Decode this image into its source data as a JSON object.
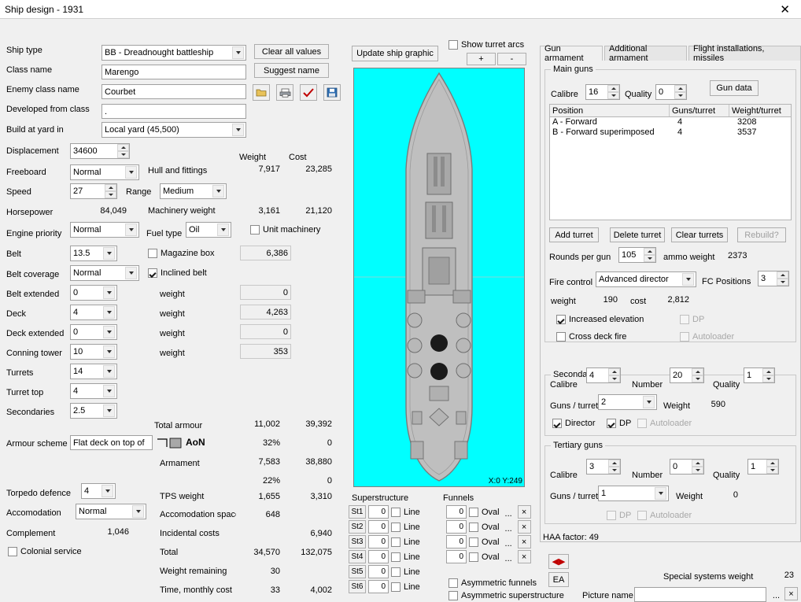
{
  "window": {
    "title": "Ship design - 1931",
    "close_icon": "close-icon"
  },
  "left": {
    "labels": {
      "ship_type": "Ship type",
      "class_name": "Class name",
      "enemy_class_name": "Enemy class name",
      "developed_from_class": "Developed from class",
      "build_at_yard_in": "Build at yard in",
      "displacement": "Displacement",
      "freeboard": "Freeboard",
      "speed": "Speed",
      "range": "Range",
      "horsepower": "Horsepower",
      "engine_priority": "Engine priority",
      "fuel_type": "Fuel type",
      "belt": "Belt",
      "belt_coverage": "Belt coverage",
      "belt_extended": "Belt extended",
      "deck": "Deck",
      "deck_extended": "Deck extended",
      "conning_tower": "Conning tower",
      "turrets": "Turrets",
      "turret_top": "Turret top",
      "secondaries": "Secondaries",
      "armour_scheme": "Armour scheme",
      "torpedo_defence": "Torpedo defence",
      "accomodation": "Accomodation",
      "complement": "Complement",
      "colonial_service": "Colonial service",
      "magazine_box": "Magazine box",
      "inclined_belt": "Inclined belt",
      "unit_machinery": "Unit machinery",
      "hull_and_fittings": "Hull and fittings",
      "machinery_weight": "Machinery weight",
      "weight": "weight",
      "total_armour": "Total armour",
      "armament": "Armament",
      "tps_weight": "TPS weight",
      "accomodation_space": "Accomodation space",
      "incidental_costs": "Incidental costs",
      "total": "Total",
      "weight_remaining": "Weight remaining",
      "time_monthly_cost": "Time, monthly cost",
      "aon": "AoN",
      "weight_col": "Weight",
      "cost_col": "Cost"
    },
    "values": {
      "ship_type": "BB - Dreadnought battleship",
      "class_name": "Marengo",
      "enemy_class_name": "Courbet",
      "developed_from_class": ".",
      "build_at_yard_in": "Local yard (45,500)",
      "displacement": "34600",
      "freeboard": "Normal",
      "speed": "27",
      "range": "Medium",
      "horsepower": "84,049",
      "engine_priority": "Normal",
      "fuel_type": "Oil",
      "belt": "13.5",
      "belt_coverage": "Normal",
      "belt_extended": "0",
      "deck": "4",
      "deck_extended": "0",
      "conning_tower": "10",
      "turrets": "14",
      "turret_top": "4",
      "secondaries": "2.5",
      "armour_scheme": "Flat deck on top of",
      "torpedo_defence": "4",
      "accomodation": "Normal",
      "complement": "1,046"
    },
    "buttons": {
      "clear_all_values": "Clear all values",
      "suggest_name": "Suggest name",
      "update_ship_graphic": "Update ship graphic",
      "folder_icon": "folder-open-icon",
      "print_icon": "print-icon",
      "check_icon": "check-icon",
      "save_icon": "save-icon",
      "show_turret_arcs": "Show turret arcs",
      "plus": "+",
      "minus": "-"
    },
    "weights": [
      {
        "name": "hull_and_fittings",
        "weight": "7,917",
        "cost": "23,285"
      },
      {
        "name": "machinery_weight",
        "weight": "3,161",
        "cost": "21,120"
      },
      {
        "name": "magazine_box_weight",
        "weight": "6,386",
        "cost": ""
      },
      {
        "name": "belt_weight",
        "weight": "0",
        "cost": ""
      },
      {
        "name": "deck_weight",
        "weight": "4,263",
        "cost": ""
      },
      {
        "name": "deck_ext_weight",
        "weight": "0",
        "cost": ""
      },
      {
        "name": "conning_weight",
        "weight": "353",
        "cost": ""
      },
      {
        "name": "total_armour",
        "weight": "11,002",
        "cost": "39,392"
      },
      {
        "name": "armour_pct",
        "weight": "32%",
        "cost": "0"
      },
      {
        "name": "armament",
        "weight": "7,583",
        "cost": "38,880"
      },
      {
        "name": "armament_pct",
        "weight": "22%",
        "cost": "0"
      },
      {
        "name": "tps_weight",
        "weight": "1,655",
        "cost": "3,310"
      },
      {
        "name": "accomodation_space",
        "weight": "648",
        "cost": ""
      },
      {
        "name": "incidental_costs",
        "weight": "",
        "cost": "6,940"
      },
      {
        "name": "total",
        "weight": "34,570",
        "cost": "132,075"
      },
      {
        "name": "weight_remaining",
        "weight": "30",
        "cost": ""
      },
      {
        "name": "time_monthly_cost",
        "weight": "33",
        "cost": "4,002"
      }
    ]
  },
  "tabs": [
    {
      "label": "Gun armament",
      "selected": true
    },
    {
      "label": "Additional armament",
      "selected": false
    },
    {
      "label": "Flight installations, missiles",
      "selected": false
    }
  ],
  "main_guns": {
    "caption": "Main guns",
    "calibre_label": "Calibre",
    "calibre": "16",
    "quality_label": "Quality",
    "quality": "0",
    "gun_data_button": "Gun data",
    "columns": [
      "Position",
      "Guns/turret",
      "Weight/turret"
    ],
    "rows": [
      {
        "position": "A - Forward",
        "guns": "4",
        "weight": "3208"
      },
      {
        "position": "B - Forward superimposed",
        "guns": "4",
        "weight": "3537"
      }
    ],
    "add_turret": "Add turret",
    "delete_turret": "Delete turret",
    "clear_turrets": "Clear turrets",
    "rebuild": "Rebuild?",
    "rounds_per_gun_label": "Rounds per gun",
    "rounds_per_gun": "105",
    "ammo_weight_label": "ammo weight",
    "ammo_weight": "2373",
    "fire_control_label": "Fire control",
    "fire_control": "Advanced director",
    "fc_positions_label": "FC Positions",
    "fc_positions": "3",
    "weight_label": "weight",
    "weight": "190",
    "cost_label": "cost",
    "cost": "2,812",
    "increased_elevation": "Increased elevation",
    "dp": "DP",
    "cross_deck_fire": "Cross deck fire",
    "autoloader": "Autoloader"
  },
  "secondary_guns": {
    "caption": "Secondary guns",
    "calibre_label": "Calibre",
    "calibre": "4",
    "number_label": "Number",
    "number": "20",
    "quality_label": "Quality",
    "quality": "1",
    "guns_per_turret_label": "Guns / turret",
    "guns_per_turret": "2",
    "weight_label": "Weight",
    "weight": "590",
    "director": "Director",
    "dp": "DP",
    "autoloader": "Autoloader"
  },
  "tertiary_guns": {
    "caption": "Tertiary guns",
    "calibre_label": "Calibre",
    "calibre": "3",
    "number_label": "Number",
    "number": "0",
    "quality_label": "Quality",
    "quality": "1",
    "guns_per_turret_label": "Guns / turret",
    "guns_per_turret": "1",
    "weight_label": "Weight",
    "weight": "0",
    "dp": "DP",
    "autoloader": "Autoloader"
  },
  "haa_factor": "HAA factor: 49",
  "superstructure": {
    "caption": "Superstructure",
    "rows": [
      {
        "btn": "St1",
        "value": "0",
        "shape": "Line"
      },
      {
        "btn": "St2",
        "value": "0",
        "shape": "Line"
      },
      {
        "btn": "St3",
        "value": "0",
        "shape": "Line"
      },
      {
        "btn": "St4",
        "value": "0",
        "shape": "Line"
      },
      {
        "btn": "St5",
        "value": "0",
        "shape": "Line"
      },
      {
        "btn": "St6",
        "value": "0",
        "shape": "Line"
      }
    ]
  },
  "funnels": {
    "caption": "Funnels",
    "rows": [
      {
        "value": "0",
        "shape": "Oval",
        "dots": "...",
        "close": "×"
      },
      {
        "value": "0",
        "shape": "Oval",
        "dots": "...",
        "close": "×"
      },
      {
        "value": "0",
        "shape": "Oval",
        "dots": "...",
        "close": "×"
      },
      {
        "value": "0",
        "shape": "Oval",
        "dots": "...",
        "close": "×"
      }
    ],
    "asymmetric_funnels": "Asymmetric funnels",
    "asymmetric_superstructure": "Asymmetric superstructure"
  },
  "footer": {
    "nav_icon": "prev-next-icon",
    "ea_button": "EA",
    "special_systems_weight_label": "Special systems weight",
    "special_systems_weight": "23",
    "picture_name_label": "Picture name",
    "picture_name": "",
    "dots": "...",
    "close": "×"
  },
  "ship_graphic": {
    "coords": "X:0 Y:249",
    "bg": "#00ffff",
    "hull": "#bfbfbf",
    "outline": "#808080"
  }
}
